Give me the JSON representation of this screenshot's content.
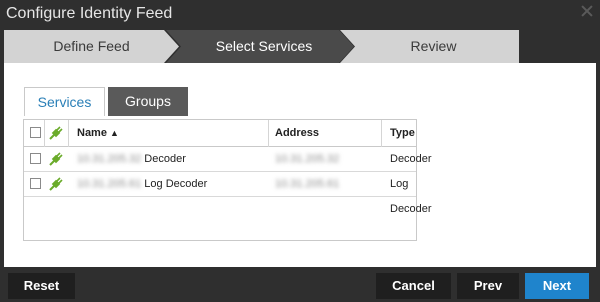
{
  "dialog": {
    "title": "Configure Identity Feed"
  },
  "wizard": {
    "steps": [
      {
        "label": "Define Feed",
        "active": false
      },
      {
        "label": "Select Services",
        "active": true
      },
      {
        "label": "Review",
        "active": false
      }
    ]
  },
  "tabs": [
    {
      "label": "Services",
      "active": true
    },
    {
      "label": "Groups",
      "active": false
    }
  ],
  "grid": {
    "columns": {
      "name": "Name",
      "address": "Address",
      "type": "Type"
    },
    "sort": {
      "column": "name",
      "direction": "ascending"
    },
    "rows": [
      {
        "name_prefix": "10.31.205.32",
        "name": "Decoder",
        "address": "10.31.205.32",
        "type": "Decoder",
        "checked": false
      },
      {
        "name_prefix": "10.31.205.61",
        "name": "Log Decoder",
        "address": "10.31.205.61",
        "type": "Log Decoder",
        "checked": false
      }
    ]
  },
  "footer": {
    "reset": "Reset",
    "cancel": "Cancel",
    "prev": "Prev",
    "next": "Next"
  },
  "colors": {
    "accent": "#1f84cc",
    "tab_active_text": "#2a7fb7",
    "plug_icon": "#6aab2a"
  },
  "icons": [
    "close-icon",
    "plug-icon",
    "sort-ascending-icon"
  ]
}
